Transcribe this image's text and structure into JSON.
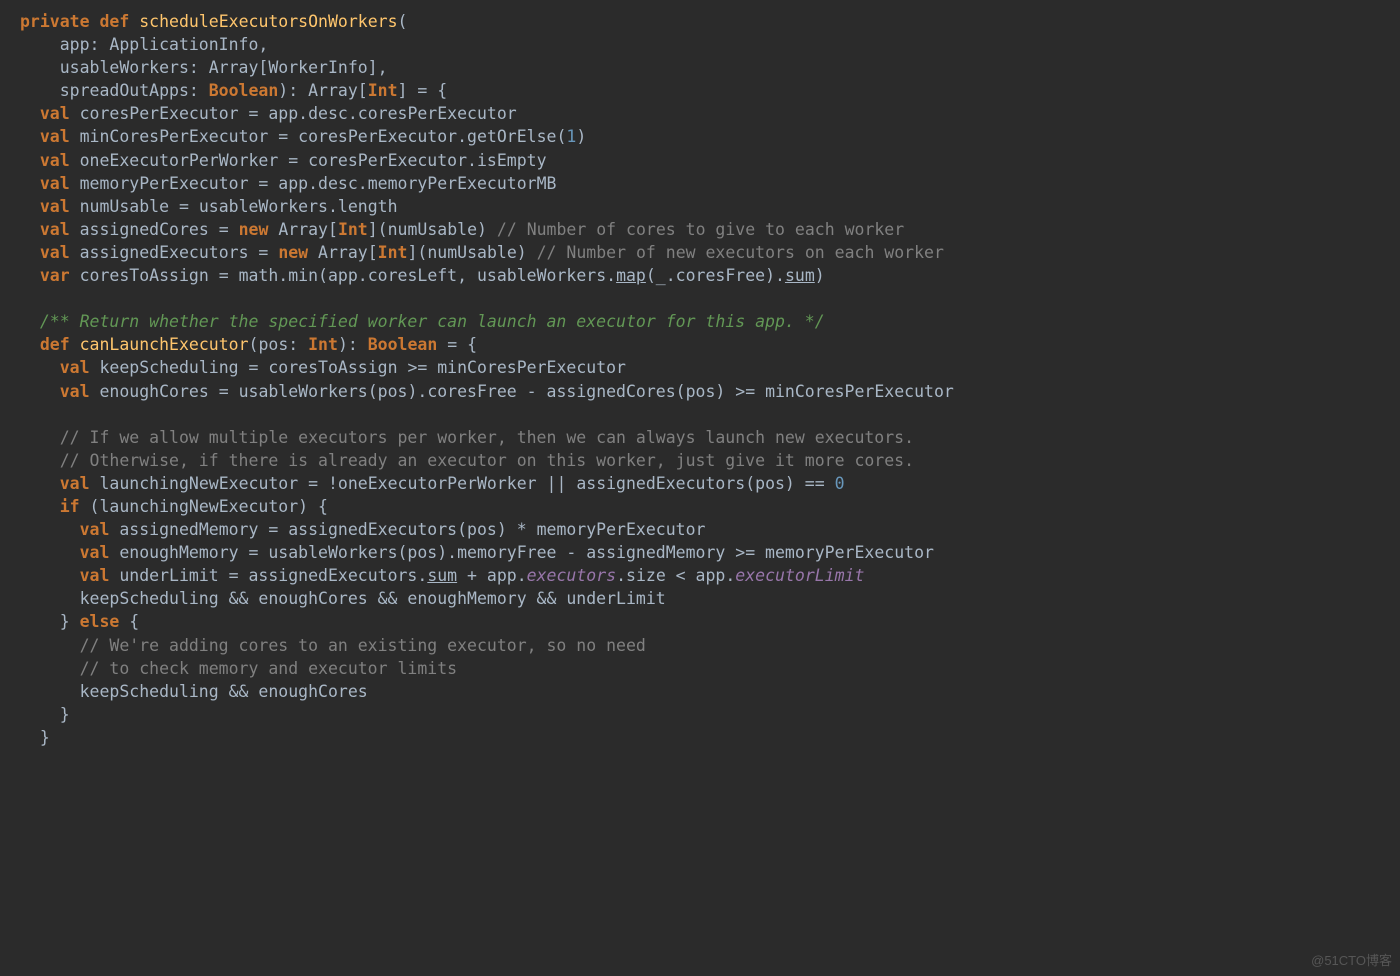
{
  "watermark": "@51CTO博客",
  "code": {
    "l1": {
      "a": "private",
      "b": " ",
      "c": "def",
      "d": " ",
      "e": "scheduleExecutorsOnWorkers",
      "f": "("
    },
    "l2": "    app: ApplicationInfo,",
    "l3": "    usableWorkers: Array[WorkerInfo],",
    "l4": {
      "a": "    spreadOutApps: ",
      "b": "Boolean",
      "c": "): Array[",
      "d": "Int",
      "e": "] = {"
    },
    "l5": {
      "a": "  ",
      "b": "val",
      "c": " coresPerExecutor = app.desc.coresPerExecutor"
    },
    "l6": {
      "a": "  ",
      "b": "val",
      "c": " minCoresPerExecutor = coresPerExecutor.getOrElse(",
      "d": "1",
      "e": ")"
    },
    "l7": {
      "a": "  ",
      "b": "val",
      "c": " oneExecutorPerWorker = coresPerExecutor.isEmpty"
    },
    "l8": {
      "a": "  ",
      "b": "val",
      "c": " memoryPerExecutor = app.desc.memoryPerExecutorMB"
    },
    "l9": {
      "a": "  ",
      "b": "val",
      "c": " numUsable = usableWorkers.length"
    },
    "l10": {
      "a": "  ",
      "b": "val",
      "c": " assignedCores = ",
      "d": "new",
      "e": " Array[",
      "f": "Int",
      "g": "](numUsable) ",
      "h": "// Number of cores to give to each worker"
    },
    "l11": {
      "a": "  ",
      "b": "val",
      "c": " assignedExecutors = ",
      "d": "new",
      "e": " Array[",
      "f": "Int",
      "g": "](numUsable) ",
      "h": "// Number of new executors on each worker"
    },
    "l12": {
      "a": "  ",
      "b": "var",
      "c": " coresToAssign = math.",
      "d": "min",
      "e": "(app.coresLeft, usableWorkers.",
      "f": "map",
      "g": "(_.coresFree).",
      "h": "sum",
      "i": ")"
    },
    "l13": "",
    "l14": "  /** Return whether the specified worker can launch an executor for this app. */",
    "l15": {
      "a": "  ",
      "b": "def",
      "c": " ",
      "d": "canLaunchExecutor",
      "e": "(pos: ",
      "f": "Int",
      "g": "): ",
      "h": "Boolean",
      "i": " = {"
    },
    "l16": {
      "a": "    ",
      "b": "val",
      "c": " keepScheduling = coresToAssign >= minCoresPerExecutor"
    },
    "l17": {
      "a": "    ",
      "b": "val",
      "c": " enoughCores = usableWorkers(pos).coresFree - assignedCores(pos) >= minCoresPerExecutor"
    },
    "l18": "",
    "l19": "    // If we allow multiple executors per worker, then we can always launch new executors.",
    "l20": "    // Otherwise, if there is already an executor on this worker, just give it more cores.",
    "l21": {
      "a": "    ",
      "b": "val",
      "c": " launchingNewExecutor = !oneExecutorPerWorker || assignedExecutors(pos) == ",
      "d": "0"
    },
    "l22": {
      "a": "    ",
      "b": "if",
      "c": " (launchingNewExecutor) {"
    },
    "l23": {
      "a": "      ",
      "b": "val",
      "c": " assignedMemory = assignedExecutors(pos) * memoryPerExecutor"
    },
    "l24": {
      "a": "      ",
      "b": "val",
      "c": " enoughMemory = usableWorkers(pos).memoryFree - assignedMemory >= memoryPerExecutor"
    },
    "l25": {
      "a": "      ",
      "b": "val",
      "c": " underLimit = assignedExecutors.",
      "d": "sum",
      "e": " + app.",
      "f": "executors",
      "g": ".size < app.",
      "h": "executorLimit"
    },
    "l26": "      keepScheduling && enoughCores && enoughMemory && underLimit",
    "l27": {
      "a": "    } ",
      "b": "else",
      "c": " {"
    },
    "l28": "      // We're adding cores to an existing executor, so no need",
    "l29": "      // to check memory and executor limits",
    "l30": "      keepScheduling && enoughCores",
    "l31": "    }",
    "l32": "  }"
  }
}
